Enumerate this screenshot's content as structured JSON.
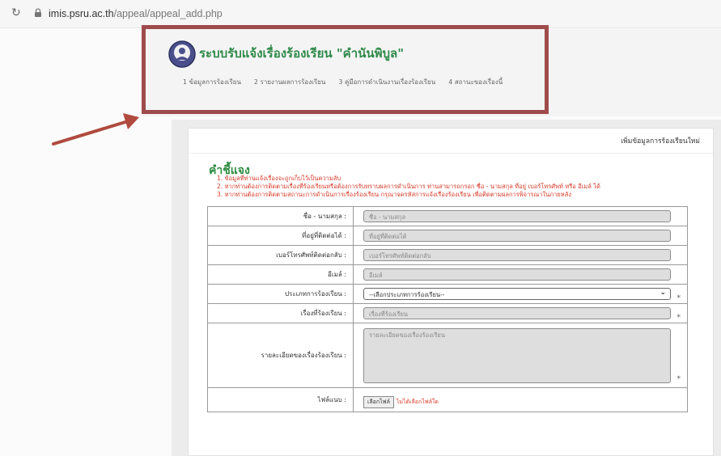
{
  "browser": {
    "url_host": "imis.psru.ac.th",
    "url_path": "/appeal/appeal_add.php"
  },
  "app": {
    "title": "ระบบรับแจ้งเรื่องร้องเรียน \"คำนันพิบูล\"",
    "steps": [
      "1 ข้อมูลการร้องเรียน",
      "2 รายงานผลการร้องเรียน",
      "3 คู่มือการดำเนินงานเรื่องร้องเรียน",
      "4 สถานะของเรื่องนี้"
    ]
  },
  "card": {
    "header": "เพิ่มข้อมูลการร้องเรียนใหม่"
  },
  "notes": {
    "heading": "คำชี้แจง",
    "items": [
      "1. ข้อมูลที่ท่านแจ้งเรื่องจะถูกเก็บไว้เป็นความลับ",
      "2. หากท่านต้องการติดตามเรื่องที่ร้องเรียนหรือต้องการรับทราบผลการดำเนินการ ท่านสามารถกรอก ชื่อ - นามสกุล ที่อยู่ เบอร์โทรศัพท์ หรือ อีเมล์ ได้",
      "3. หากท่านต้องการติดตามสถานะการดำเนินการเรื่องร้องเรียน กรุณาจดรหัสการแจ้งเรื่องร้องเรียน เพื่อติดตามผลการพิจารณาในภายหลัง"
    ]
  },
  "form": {
    "fields": [
      {
        "label": "ชื่อ - นามสกุล :",
        "placeholder": "ชื่อ - นามสกุล",
        "type": "text"
      },
      {
        "label": "ที่อยู่ที่ติดต่อได้ :",
        "placeholder": "ที่อยู่ที่ติดต่อได้",
        "type": "text"
      },
      {
        "label": "เบอร์โทรศัพท์ติดต่อกลับ :",
        "placeholder": "เบอร์โทรศัพท์ติดต่อกลับ",
        "type": "text"
      },
      {
        "label": "อีเมล์ :",
        "placeholder": "อีเมล์",
        "type": "text"
      },
      {
        "label": "ประเภทการร้องเรียน :",
        "placeholder": "--เลือกประเภทการร้องเรียน--",
        "type": "select"
      },
      {
        "label": "เรื่องที่ร้องเรียน :",
        "placeholder": "เรื่องที่ร้องเรียน",
        "type": "text"
      },
      {
        "label": "รายละเอียดของเรื่องร้องเรียน :",
        "placeholder": "รายละเอียดของเรื่องร้องเรียน",
        "type": "textarea"
      },
      {
        "label": "ไฟล์แนบ :",
        "button": "เลือกไฟล์",
        "hint": "ไม่ได้เลือกไฟล์ใด",
        "type": "file"
      }
    ],
    "required_mark": "*"
  }
}
